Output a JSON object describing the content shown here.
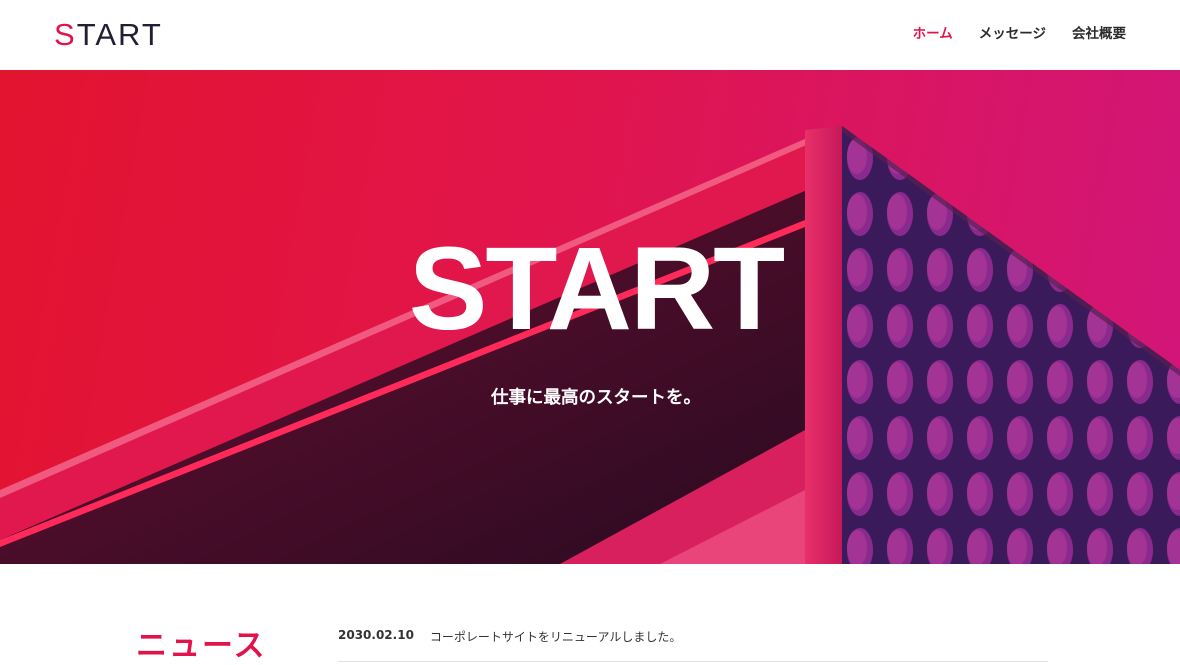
{
  "header": {
    "logo_first": "S",
    "logo_rest": "TART",
    "nav": [
      {
        "label": "ホーム",
        "active": true
      },
      {
        "label": "メッセージ",
        "active": false
      },
      {
        "label": "会社概要",
        "active": false
      }
    ]
  },
  "hero": {
    "title": "START",
    "subtitle": "仕事に最高のスタートを。"
  },
  "news": {
    "heading": "ニュース",
    "items": [
      {
        "date": "2030.02.10",
        "text": "コーポレートサイトをリニューアルしました。"
      }
    ]
  },
  "colors": {
    "accent": "#e2134a",
    "text": "#2b2b2b",
    "hero_red": "#e3142f",
    "hero_magenta": "#d1157a"
  }
}
